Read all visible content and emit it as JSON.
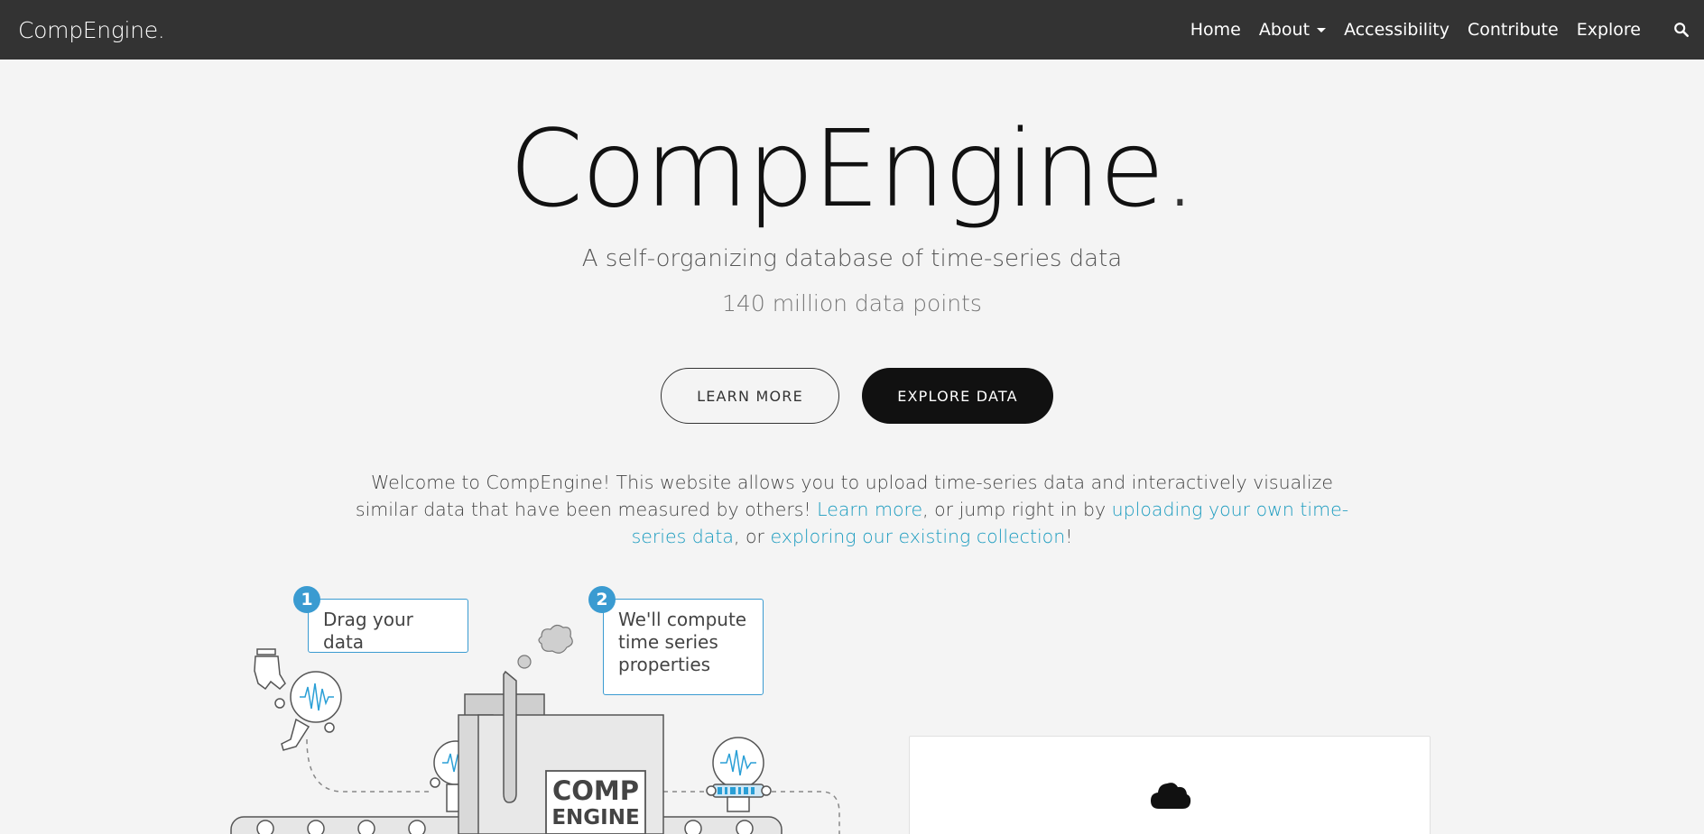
{
  "nav": {
    "brand": "CompEngine.",
    "links": [
      "Home",
      "About",
      "Accessibility",
      "Contribute",
      "Explore"
    ]
  },
  "hero": {
    "title": "CompEngine",
    "title_dot": ".",
    "tagline": "A self-organizing database of time-series data",
    "datapoints": "140 million data points",
    "learn_more_label": "LEARN MORE",
    "explore_label": "EXPLORE DATA"
  },
  "welcome": {
    "text_1": "Welcome to CompEngine! This website allows you to upload time-series data and interactively visualize similar data that have been measured by others! ",
    "link_learn": "Learn more",
    "text_2": ", or jump right in by ",
    "link_upload": "uploading your own time-series data",
    "text_3": ", or ",
    "link_explore": "exploring our existing collection",
    "text_4": "!"
  },
  "illustration": {
    "step1_num": "1",
    "step1_text": "Drag your data",
    "step2_num": "2",
    "step2_text": "We'll compute time series properties",
    "engine_line1": "COMP",
    "engine_line2": "ENGINE"
  },
  "colors": {
    "navbar": "#333333",
    "background": "#f4f4f4",
    "link": "#1a9bbf",
    "accent": "#3a9bd1"
  }
}
